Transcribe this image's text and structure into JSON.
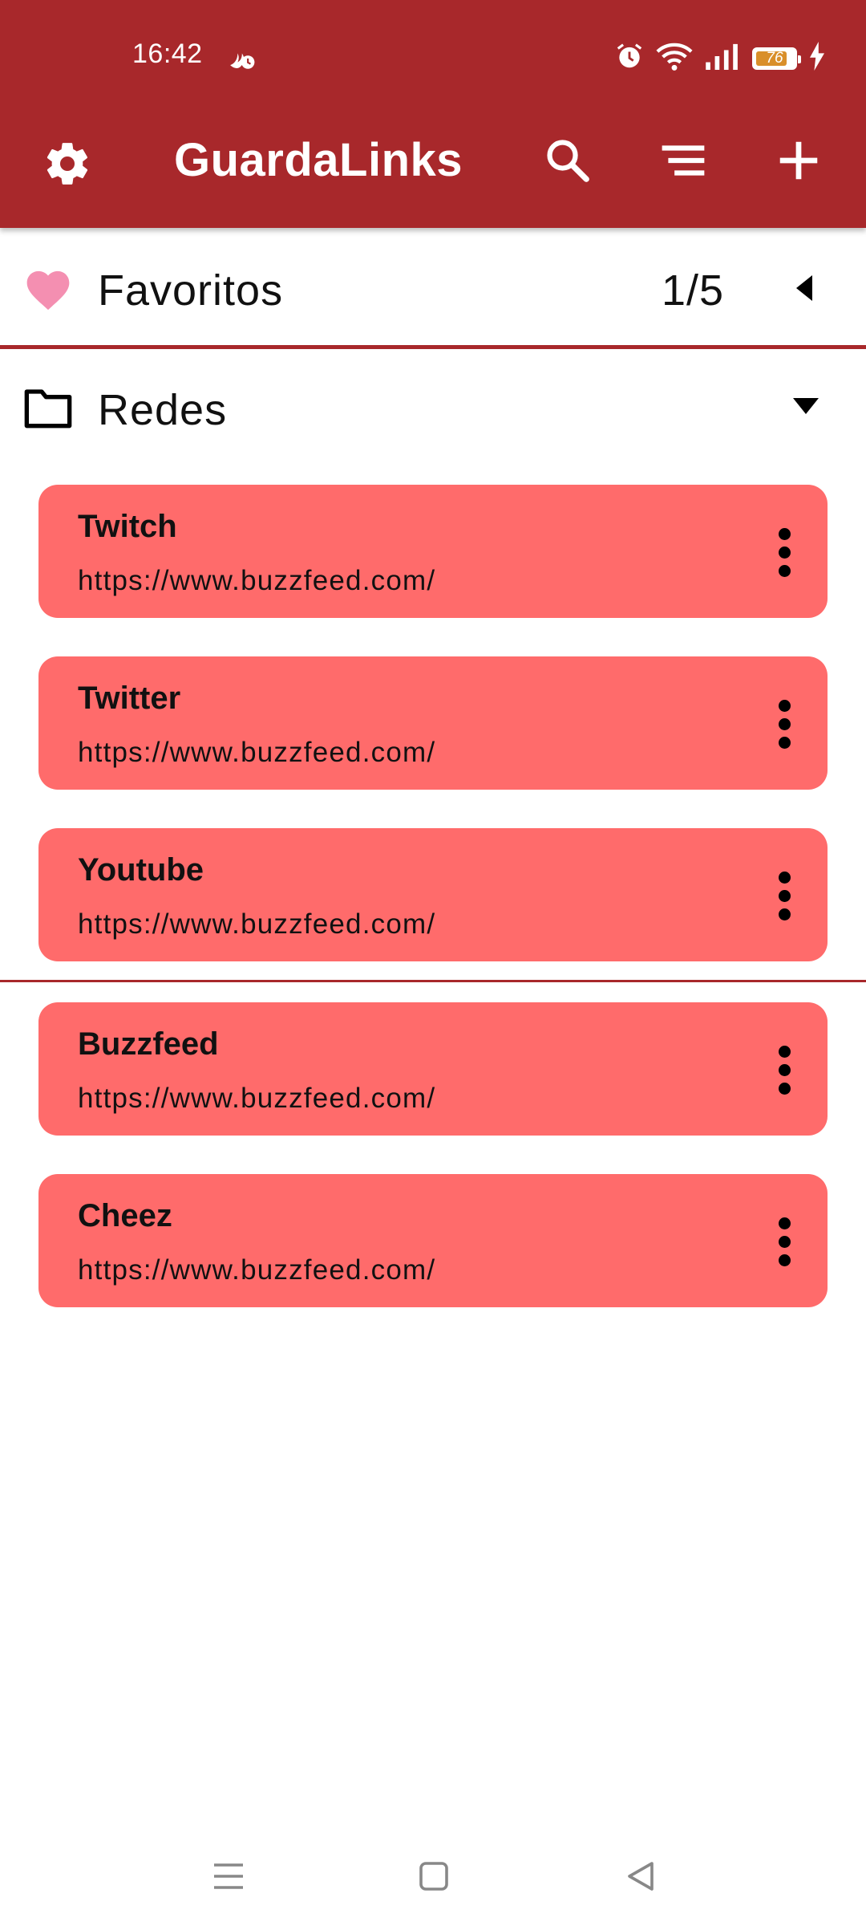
{
  "status_bar": {
    "time": "16:42",
    "battery_level": "76",
    "icons": [
      "alarm-icon",
      "wifi-icon",
      "signal-icon",
      "battery-icon",
      "charging-icon"
    ]
  },
  "appbar": {
    "title": "GuardaLinks",
    "background": "#a8282b",
    "icons": [
      "gear-icon",
      "search-icon",
      "sort-icon",
      "add-icon"
    ]
  },
  "favorites": {
    "label": "Favoritos",
    "counter": "1/5",
    "icon": "heart-icon",
    "heart_color": "#f48fb1"
  },
  "folder": {
    "label": "Redes",
    "icon": "folder-icon",
    "links": [
      {
        "name": "Twitch",
        "url": "https://www.buzzfeed.com/"
      },
      {
        "name": "Twitter",
        "url": "https://www.buzzfeed.com/"
      },
      {
        "name": "Youtube",
        "url": "https://www.buzzfeed.com/"
      }
    ]
  },
  "other_links": [
    {
      "name": "Buzzfeed",
      "url": "https://www.buzzfeed.com/"
    },
    {
      "name": "Cheez",
      "url": "https://www.buzzfeed.com/"
    }
  ],
  "card_color": "#ff6b6b",
  "nav_bar": {
    "icons": [
      "recents-icon",
      "home-icon",
      "back-icon"
    ]
  }
}
